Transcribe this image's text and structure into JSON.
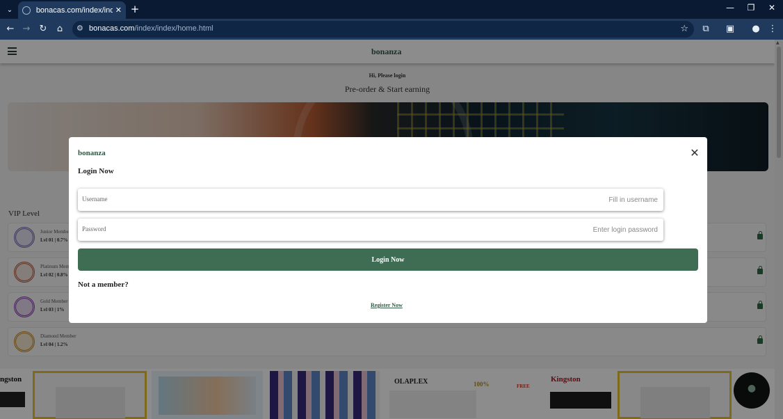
{
  "browser": {
    "tab_title": "bonacas.com/index/index/home.html",
    "url_domain": "bonacas.com",
    "url_path": "/index/index/home.html"
  },
  "site": {
    "logo": "bonanza",
    "greeting": "Hi, Please login",
    "tagline": "Pre-order & Start earning",
    "vip_title": "VIP Level",
    "vip_levels": [
      {
        "name": "Junior Member",
        "level": "Lvl 01 | 0.7%"
      },
      {
        "name": "Platinum Member",
        "level": "Lvl 02 | 0.8%"
      },
      {
        "name": "Gold Member",
        "level": "Lvl 03 | 1%"
      },
      {
        "name": "Diamond Member",
        "level": "Lvl 04 | 1.2%"
      }
    ],
    "product_texts": {
      "kingston_left": "ngston",
      "olaplex": "OLAPLEX",
      "free": "FREE",
      "guarantee": "100%",
      "kingston_right": "Kingston"
    }
  },
  "modal": {
    "logo": "bonanza",
    "heading": "Login Now",
    "username_label": "Username",
    "username_placeholder": "Fill in username",
    "password_label": "Password",
    "password_placeholder": "Enter login password",
    "login_button": "Login Now",
    "not_member": "Not a member?",
    "register_link": "Register Now"
  },
  "colors": {
    "brand_green": "#3f6d54",
    "browser_dark": "#0b1a33",
    "browser_toolbar": "#1f3a5c",
    "lock_green": "#2f6b46"
  }
}
